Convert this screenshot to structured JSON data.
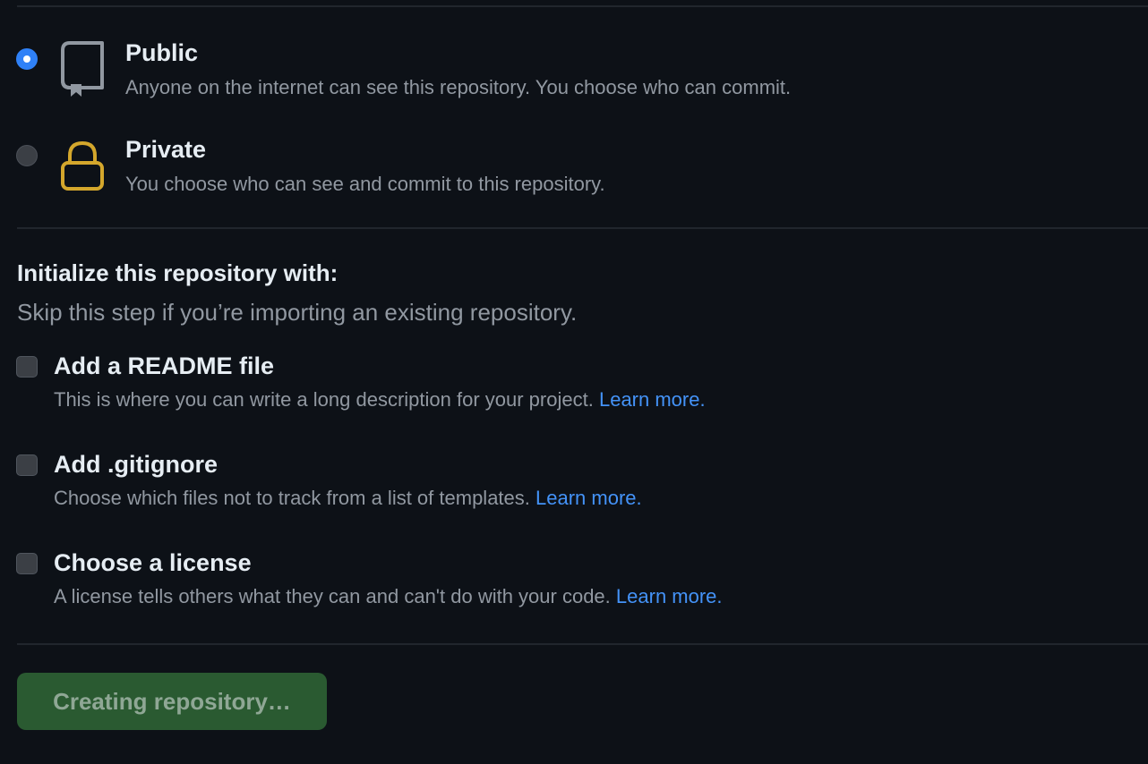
{
  "visibility": {
    "options": [
      {
        "title": "Public",
        "description": "Anyone on the internet can see this repository. You choose who can commit.",
        "icon": "repo-book-icon",
        "checked": true
      },
      {
        "title": "Private",
        "description": "You choose who can see and commit to this repository.",
        "icon": "lock-icon",
        "checked": false
      }
    ]
  },
  "initialize": {
    "heading": "Initialize this repository with:",
    "subheading": "Skip this step if you’re importing an existing repository.",
    "options": [
      {
        "title": "Add a README file",
        "description": "This is where you can write a long description for your project.",
        "link": "Learn more.",
        "checked": false
      },
      {
        "title": "Add .gitignore",
        "description": "Choose which files not to track from a list of templates.",
        "link": "Learn more.",
        "checked": false
      },
      {
        "title": "Choose a license",
        "description": "A license tells others what they can and can't do with your code.",
        "link": "Learn more.",
        "checked": false
      }
    ]
  },
  "submit": {
    "label": "Creating repository…",
    "disabled": true
  },
  "colors": {
    "background": "#0d1117",
    "accent_blue": "#2f81f7",
    "link": "#4493f8",
    "lock_icon": "#d4a72c",
    "button_bg": "#2a5a31"
  }
}
